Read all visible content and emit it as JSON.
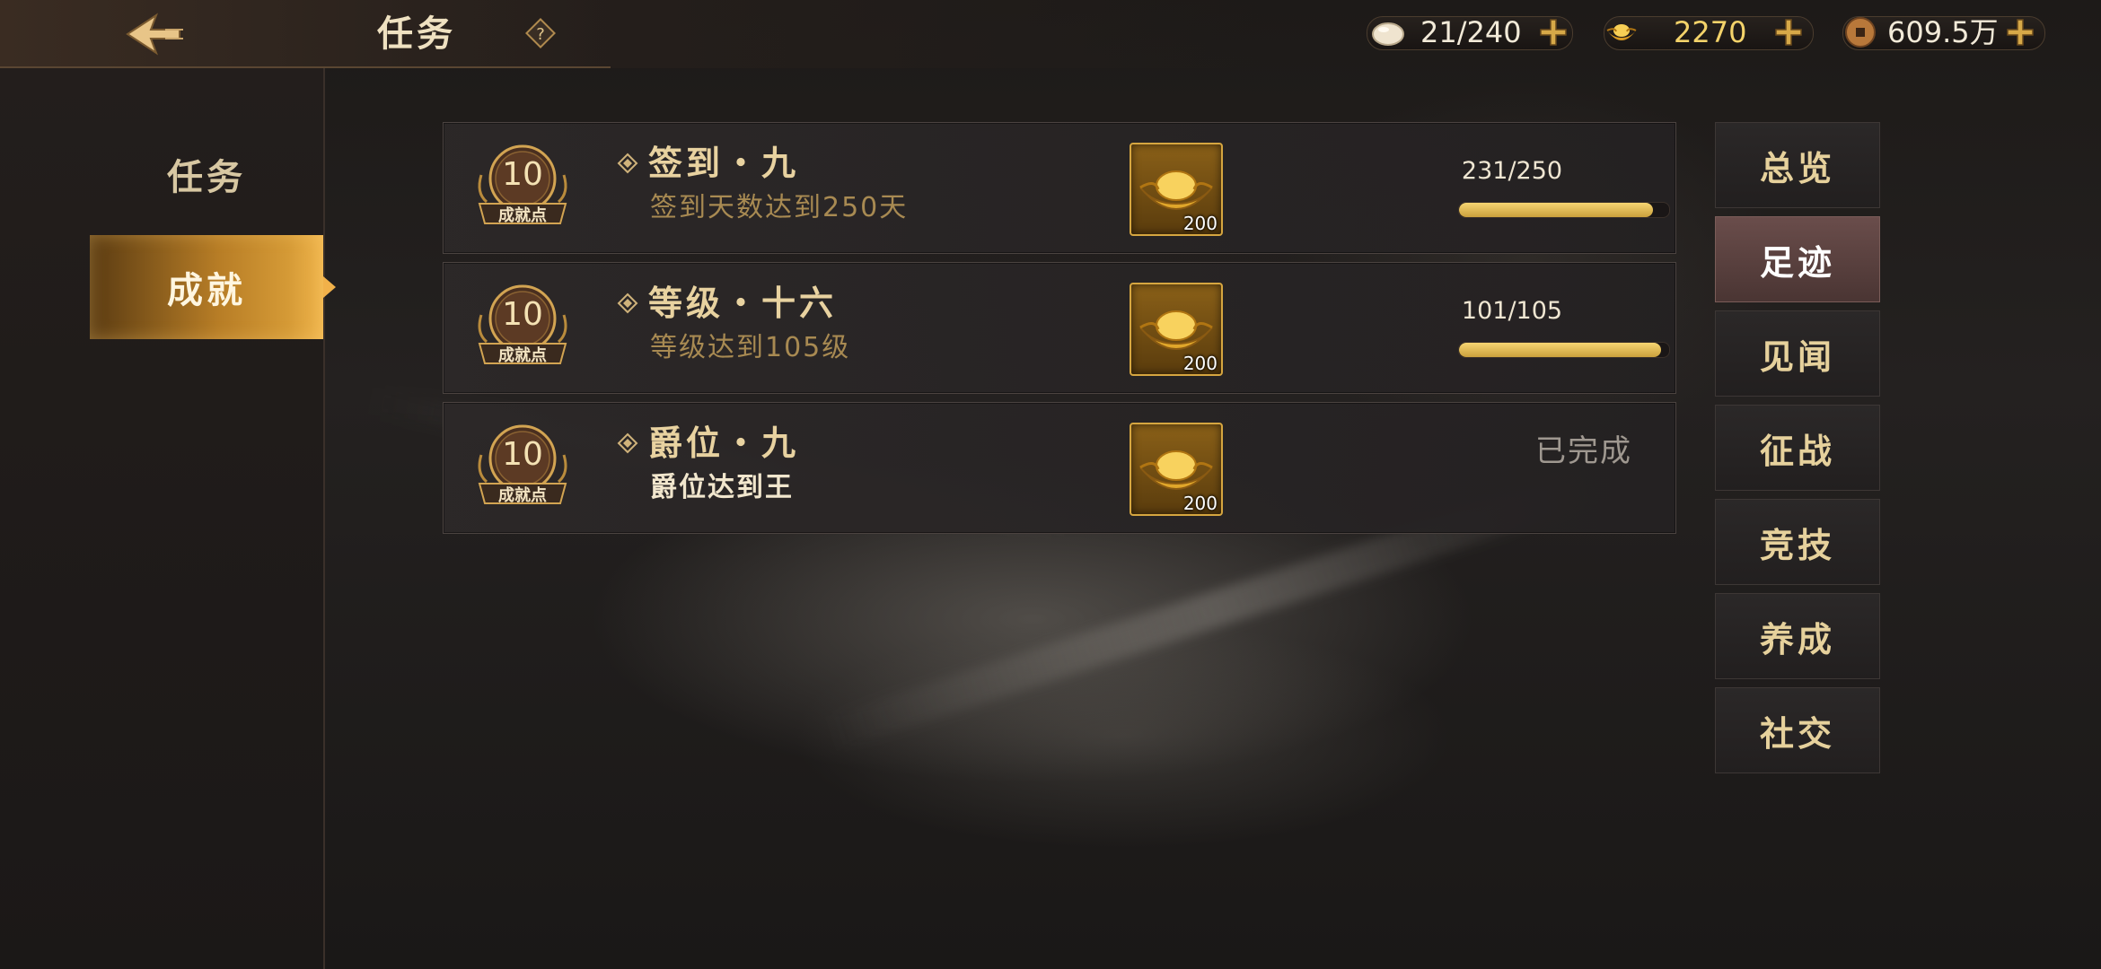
{
  "header": {
    "title": "任务",
    "help_icon": "question-icon",
    "back_icon": "back-arrow-icon"
  },
  "resources": {
    "stamina": {
      "icon": "bun-icon",
      "value": "21/240"
    },
    "gold_ingot": {
      "icon": "gold-ingot-icon",
      "value": "2270"
    },
    "coins": {
      "icon": "copper-coin-icon",
      "value": "609.5万"
    }
  },
  "sidebar": {
    "items": [
      {
        "label": "任务",
        "active": false
      },
      {
        "label": "成就",
        "active": true
      }
    ]
  },
  "achievements": [
    {
      "points": "10",
      "points_label": "成就点",
      "title": "签到・九",
      "desc": "签到天数达到250天",
      "reward_qty": "200",
      "progress_text": "231/250",
      "progress": 0.924,
      "status": ""
    },
    {
      "points": "10",
      "points_label": "成就点",
      "title": "等级・十六",
      "desc": "等级达到105级",
      "reward_qty": "200",
      "progress_text": "101/105",
      "progress": 0.962,
      "status": ""
    },
    {
      "points": "10",
      "points_label": "成就点",
      "title": "爵位・九",
      "desc": "爵位达到王",
      "reward_qty": "200",
      "progress_text": "",
      "progress": null,
      "status": "已完成"
    }
  ],
  "categories": [
    {
      "label": "总览",
      "active": false
    },
    {
      "label": "足迹",
      "active": true
    },
    {
      "label": "见闻",
      "active": false
    },
    {
      "label": "征战",
      "active": false
    },
    {
      "label": "竞技",
      "active": false
    },
    {
      "label": "养成",
      "active": false
    },
    {
      "label": "社交",
      "active": false
    }
  ],
  "colors": {
    "gold_accent": "#e8b548",
    "active_tab": "#b77d26",
    "active_category": "#5a403e"
  }
}
